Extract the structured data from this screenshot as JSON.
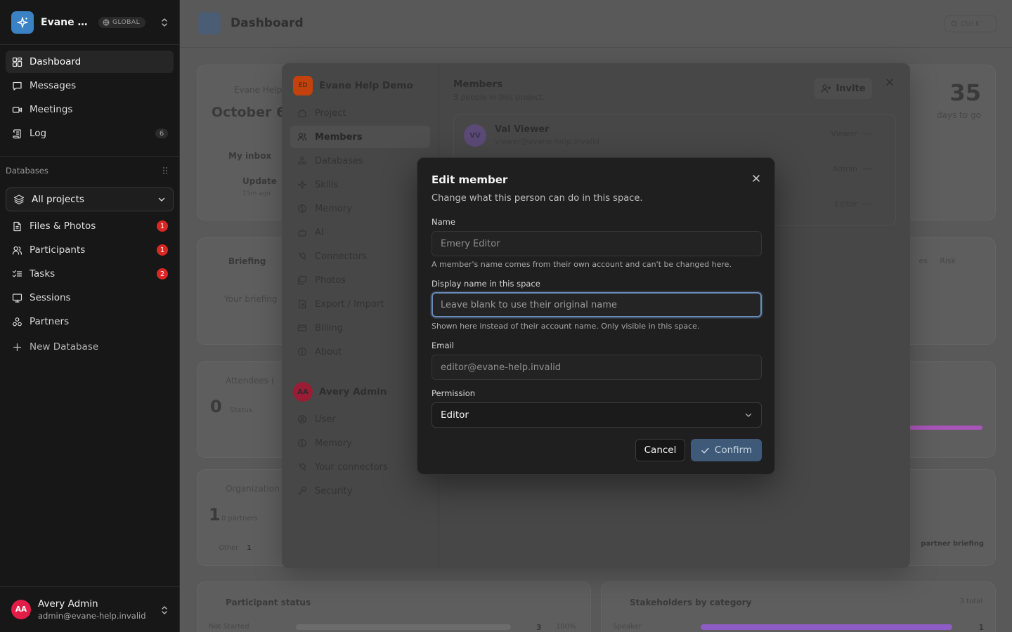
{
  "workspace": {
    "name": "Evane Help Demo",
    "scope_badge": "GLOBAL",
    "initials": "ED"
  },
  "sidebar": {
    "nav": [
      {
        "label": "Dashboard",
        "icon": "dashboard-grid-icon",
        "active": true
      },
      {
        "label": "Messages",
        "icon": "message-icon"
      },
      {
        "label": "Meetings",
        "icon": "video-icon"
      },
      {
        "label": "Log",
        "icon": "scroll-icon",
        "count": "6"
      }
    ],
    "databases_heading": "Databases",
    "project_select": "All projects",
    "databases": [
      {
        "label": "Files & Photos",
        "icon": "file-icon",
        "count": "1"
      },
      {
        "label": "Participants",
        "icon": "users-icon",
        "count": "1"
      },
      {
        "label": "Tasks",
        "icon": "checklist-icon",
        "count": "2"
      },
      {
        "label": "Sessions",
        "icon": "monitor-icon"
      },
      {
        "label": "Partners",
        "icon": "boxes-icon"
      }
    ],
    "new_database": "New Database"
  },
  "user": {
    "initials": "AA",
    "name": "Avery Admin",
    "email": "admin@evane-help.invalid"
  },
  "topbar": {
    "title": "Dashboard",
    "search_shortcut": "Ctrl K"
  },
  "background": {
    "calendar_title": "Evane Help Demo",
    "date": "October 6",
    "countdown_value": "35",
    "countdown_label": "days to go",
    "inbox_title": "My inbox",
    "inbox_item": "Update",
    "inbox_time": "15m ago",
    "briefing_title": "Briefing",
    "briefing_placeholder": "Your briefing",
    "briefing_tabs": [
      "es",
      "Risk"
    ],
    "attendees_title": "Attendees (",
    "attendees_count": "0",
    "attendees_status": "Status",
    "org_title": "Organization",
    "org_count": "1",
    "org_sub": "0 partners",
    "org_other": "Other",
    "org_other_count": "1",
    "partner_briefing": "partner briefing",
    "participant_status_title": "Participant status",
    "participant_row_label": "Not Started",
    "participant_row_count": "3",
    "participant_row_pct": "100%",
    "stakeholders_title": "Stakeholders by category",
    "stakeholders_total": "3 total",
    "stakeholders_row_label": "Speaker",
    "stakeholders_row_count": "1"
  },
  "settings": {
    "workspace_name": "Evane Help Demo",
    "workspace_initials": "ED",
    "project_items": [
      {
        "label": "Project",
        "icon": "home-icon"
      },
      {
        "label": "Members",
        "icon": "users-icon",
        "active": true
      },
      {
        "label": "Databases",
        "icon": "boxes-icon"
      },
      {
        "label": "Skills",
        "icon": "sparkle-icon"
      },
      {
        "label": "Memory",
        "icon": "brain-icon"
      },
      {
        "label": "AI",
        "icon": "bot-icon"
      },
      {
        "label": "Connectors",
        "icon": "plug-icon"
      },
      {
        "label": "Photos",
        "icon": "images-icon"
      },
      {
        "label": "Export / Import",
        "icon": "export-icon"
      },
      {
        "label": "Billing",
        "icon": "card-icon"
      },
      {
        "label": "About",
        "icon": "info-icon"
      }
    ],
    "user_initials": "AA",
    "user_name": "Avery Admin",
    "user_items": [
      {
        "label": "User",
        "icon": "user-circle-icon"
      },
      {
        "label": "Memory",
        "icon": "brain-icon"
      },
      {
        "label": "Your connectors",
        "icon": "plug-icon"
      },
      {
        "label": "Security",
        "icon": "key-icon"
      }
    ],
    "members_title": "Members",
    "members_sub": "3 people in this project.",
    "invite_label": "Invite",
    "members": [
      {
        "initials": "VV",
        "name": "Val Viewer",
        "email": "viewer@evane-help.invalid",
        "role": "Viewer"
      },
      {
        "initials": "",
        "name": "",
        "email": "",
        "role": "Admin"
      },
      {
        "initials": "",
        "name": "",
        "email": "",
        "role": "Editor"
      }
    ]
  },
  "modal": {
    "title": "Edit member",
    "subtitle": "Change what this person can do in this space.",
    "name_label": "Name",
    "name_value": "Emery Editor",
    "name_hint": "A member's name comes from their own account and can't be changed here.",
    "display_label": "Display name in this space",
    "display_placeholder": "Leave blank to use their original name",
    "display_hint": "Shown here instead of their account name. Only visible in this space.",
    "email_label": "Email",
    "email_value": "editor@evane-help.invalid",
    "permission_label": "Permission",
    "permission_value": "Editor",
    "cancel_label": "Cancel",
    "confirm_label": "Confirm"
  },
  "colors": {
    "accent": "#3b82c4",
    "danger": "#dc2626",
    "confirm": "#3e5a78",
    "focus_ring": "#6b8cba"
  }
}
